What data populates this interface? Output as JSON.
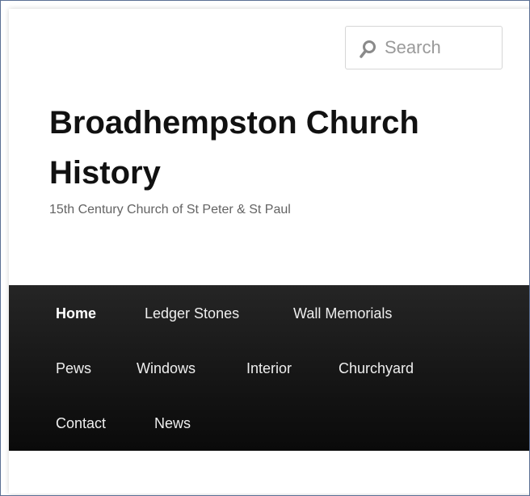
{
  "search": {
    "placeholder": "Search"
  },
  "site": {
    "title_line1": "Broadhempston Church",
    "title_line2": "History",
    "description": "15th Century Church of St Peter & St Paul"
  },
  "nav": {
    "items": [
      {
        "label": "Home",
        "active": true
      },
      {
        "label": "Ledger Stones"
      },
      {
        "label": "Wall Memorials"
      },
      {
        "label": "Pews"
      },
      {
        "label": "Windows"
      },
      {
        "label": "Interior"
      },
      {
        "label": "Churchyard"
      },
      {
        "label": "Contact"
      },
      {
        "label": "News"
      }
    ]
  },
  "colors": {
    "nav_bg": "#1a1a1a",
    "frame_border": "#5a6f94"
  }
}
